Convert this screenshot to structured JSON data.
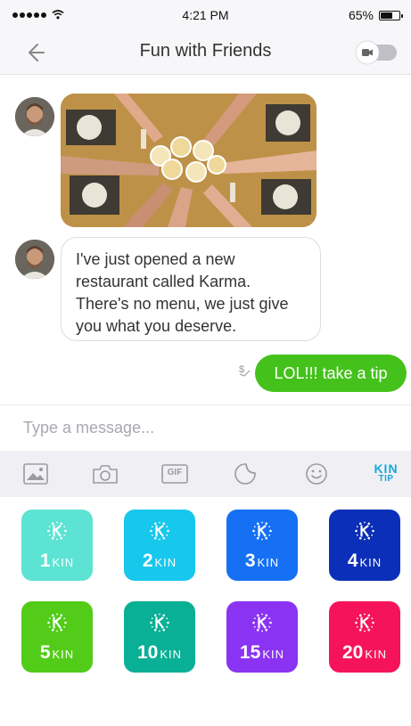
{
  "status_bar": {
    "time": "4:21 PM",
    "battery": "65%",
    "battery_level": 0.65
  },
  "header": {
    "title": "Fun with Friends"
  },
  "messages": {
    "incoming_text": "I've just opened a new restaurant called Karma. There's no menu, we just give you what you deserve.",
    "outgoing_text": "LOL!!! take a tip"
  },
  "composer": {
    "placeholder": "Type a message..."
  },
  "toolbar": {
    "kin_label": "KIN",
    "tip_label": "TIP",
    "gif_label": "GIF"
  },
  "tips": [
    {
      "amount": "1",
      "unit": "KIN",
      "color": "#5de3d3"
    },
    {
      "amount": "2",
      "unit": "KIN",
      "color": "#17c7ec"
    },
    {
      "amount": "3",
      "unit": "KIN",
      "color": "#1570f4"
    },
    {
      "amount": "4",
      "unit": "KIN",
      "color": "#0b2fb8"
    },
    {
      "amount": "5",
      "unit": "KIN",
      "color": "#52cc18"
    },
    {
      "amount": "10",
      "unit": "KIN",
      "color": "#0ab095"
    },
    {
      "amount": "15",
      "unit": "KIN",
      "color": "#8a33f2"
    },
    {
      "amount": "20",
      "unit": "KIN",
      "color": "#f5145c"
    }
  ],
  "colors": {
    "accent_green": "#44c21b",
    "kin_blue": "#17a8d9"
  },
  "icons": [
    "wifi-icon",
    "back-arrow-icon",
    "video-toggle-icon",
    "image-icon",
    "camera-icon",
    "gif-icon",
    "sticker-icon",
    "emoji-icon",
    "tip-dollar-icon",
    "kin-logo-icon"
  ]
}
